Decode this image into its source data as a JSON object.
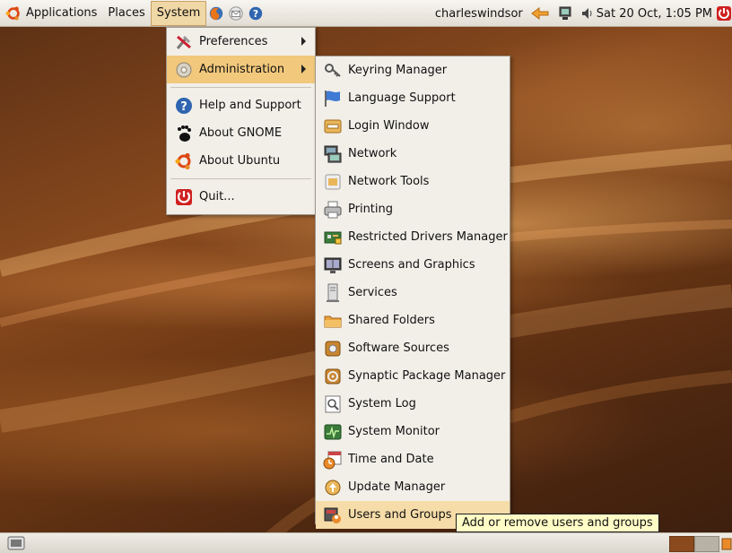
{
  "top_panel": {
    "menus": [
      "Applications",
      "Places",
      "System"
    ],
    "username": "charleswindsor",
    "clock": "Sat 20 Oct,  1:05 PM"
  },
  "system_menu": {
    "items": [
      {
        "label": "Preferences",
        "icon": "preferences-icon",
        "submenu": true
      },
      {
        "label": "Administration",
        "icon": "administration-icon",
        "submenu": true
      },
      {
        "label": "Help and Support",
        "icon": "help-icon",
        "submenu": false
      },
      {
        "label": "About GNOME",
        "icon": "gnome-foot-icon",
        "submenu": false
      },
      {
        "label": "About Ubuntu",
        "icon": "ubuntu-logo-icon",
        "submenu": false
      },
      {
        "label": "Quit...",
        "icon": "quit-icon",
        "submenu": false
      }
    ]
  },
  "admin_menu": {
    "items": [
      "Keyring Manager",
      "Language Support",
      "Login Window",
      "Network",
      "Network Tools",
      "Printing",
      "Restricted Drivers Manager",
      "Screens and Graphics",
      "Services",
      "Shared Folders",
      "Software Sources",
      "Synaptic Package Manager",
      "System Log",
      "System Monitor",
      "Time and Date",
      "Update Manager",
      "Users and Groups"
    ]
  },
  "tooltip": "Add or remove users and groups",
  "colors": {
    "menu_highlight": "#f2c87c",
    "menu_bg": "#f2efe9",
    "tooltip_bg": "#fffcc6"
  }
}
